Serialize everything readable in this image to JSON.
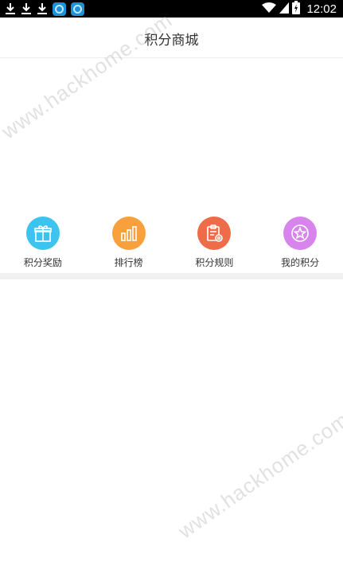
{
  "status_bar": {
    "time": "12:02",
    "left_icons": [
      "download-icon",
      "download-icon",
      "download-icon",
      "app-icon",
      "app-icon"
    ],
    "right_icons": [
      "wifi-icon",
      "signal-icon",
      "battery-icon"
    ]
  },
  "header": {
    "title": "积分商城"
  },
  "nav": {
    "items": [
      {
        "label": "积分奖励",
        "icon": "gift-icon",
        "color": "#3cc4ee"
      },
      {
        "label": "排行榜",
        "icon": "bar-chart-icon",
        "color": "#f7a03c"
      },
      {
        "label": "积分规则",
        "icon": "clipboard-icon",
        "color": "#ef6c4a"
      },
      {
        "label": "我的积分",
        "icon": "star-icon",
        "color": "#d784ec"
      }
    ]
  },
  "watermarks": [
    "www.hackhome.com",
    "www.hackhome.com"
  ]
}
